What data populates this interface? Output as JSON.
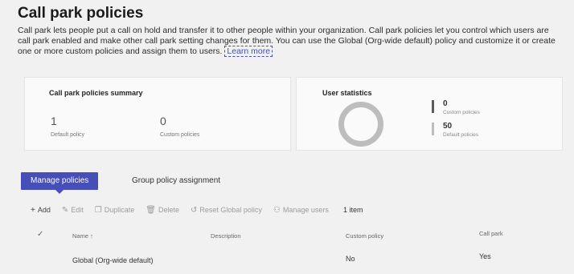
{
  "header": {
    "title": "Call park policies",
    "description": "Call park lets people put a call on hold and transfer it to other people within your organization. Call park policies let you control which users are call park enabled and make other call park setting changes for them. You can use the Global (Org-wide default) policy and customize it or create one or more custom policies and assign them to users.",
    "learn_more": "Learn more"
  },
  "summary": {
    "title": "Call park policies summary",
    "default_value": "1",
    "default_label": "Default policy",
    "custom_value": "0",
    "custom_label": "Custom policies"
  },
  "stats": {
    "title": "User statistics",
    "custom_value": "0",
    "custom_label": "Custom policies",
    "default_value": "50",
    "default_label": "Default policies",
    "colors": {
      "custom": "#5b5b5b",
      "default": "#bdbdbd"
    }
  },
  "tabs": [
    {
      "label": "Manage policies",
      "active": true
    },
    {
      "label": "Group policy assignment",
      "active": false
    }
  ],
  "toolbar": {
    "add": "Add",
    "edit": "Edit",
    "duplicate": "Duplicate",
    "delete": "Delete",
    "reset": "Reset Global policy",
    "manage_users": "Manage users",
    "count": "1 item"
  },
  "table": {
    "columns": [
      "Name ↑",
      "Description",
      "Custom policy",
      "Call park"
    ],
    "rows": [
      {
        "name": "Global (Org-wide default)",
        "description": "",
        "custom_policy": "No",
        "call_park": "Yes"
      }
    ]
  },
  "accent_color": "#464eb8"
}
